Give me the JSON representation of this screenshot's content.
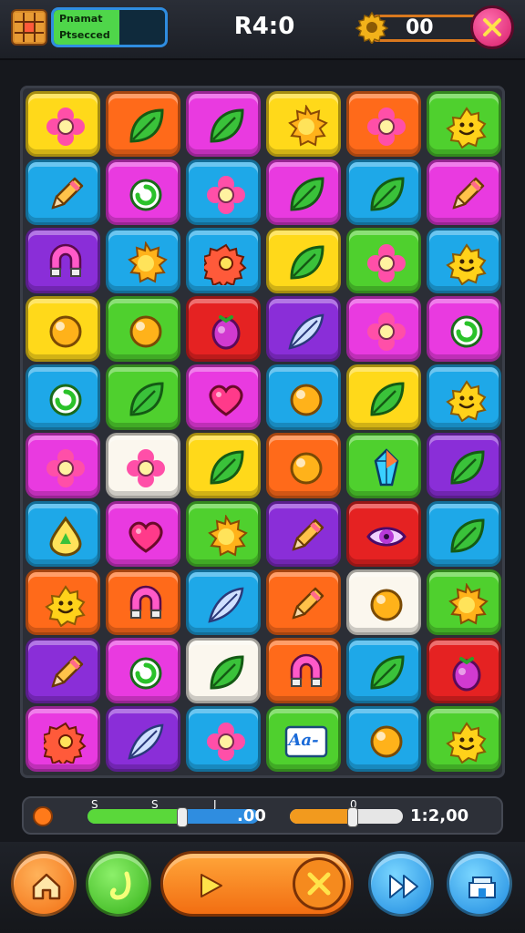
{
  "header": {
    "player_line1": "Pnamat",
    "player_line2": "Ptsecced",
    "score": "R4:0",
    "coins": "00"
  },
  "progress": {
    "left_labels": [
      "S",
      "S",
      "J"
    ],
    "left_value": ".00",
    "left_fill": 0.55,
    "right_label": "0",
    "right_value": "1:2,00",
    "right_fill": 0.55
  },
  "colors": {
    "yellow": "#ffd91a",
    "orange": "#ff6a1a",
    "magenta": "#e93ae0",
    "blue": "#1ea8e8",
    "green": "#4fd02e",
    "purple": "#8a2ed8",
    "red": "#e52222",
    "white": "#fbf7ee"
  },
  "grid": [
    [
      {
        "bg": "yellow",
        "icon": "flower-icon"
      },
      {
        "bg": "orange",
        "icon": "leaf-icon"
      },
      {
        "bg": "magenta",
        "icon": "leaf-icon"
      },
      {
        "bg": "yellow",
        "icon": "sun-icon"
      },
      {
        "bg": "orange",
        "icon": "flower-icon"
      },
      {
        "bg": "green",
        "icon": "smiley-icon"
      }
    ],
    [
      {
        "bg": "blue",
        "icon": "pencil-icon"
      },
      {
        "bg": "magenta",
        "icon": "swirl-icon"
      },
      {
        "bg": "blue",
        "icon": "flower-icon"
      },
      {
        "bg": "magenta",
        "icon": "leaf-icon"
      },
      {
        "bg": "blue",
        "icon": "leaf-icon"
      },
      {
        "bg": "magenta",
        "icon": "pencil-icon"
      }
    ],
    [
      {
        "bg": "purple",
        "icon": "magnet-icon"
      },
      {
        "bg": "blue",
        "icon": "sun-icon"
      },
      {
        "bg": "blue",
        "icon": "gear-icon"
      },
      {
        "bg": "yellow",
        "icon": "leaf-icon"
      },
      {
        "bg": "green",
        "icon": "flower-icon"
      },
      {
        "bg": "blue",
        "icon": "smiley-icon"
      }
    ],
    [
      {
        "bg": "yellow",
        "icon": "orb-icon"
      },
      {
        "bg": "green",
        "icon": "orb-icon"
      },
      {
        "bg": "red",
        "icon": "berry-icon"
      },
      {
        "bg": "purple",
        "icon": "feather-icon"
      },
      {
        "bg": "magenta",
        "icon": "flower-icon"
      },
      {
        "bg": "magenta",
        "icon": "swirl-icon"
      }
    ],
    [
      {
        "bg": "blue",
        "icon": "swirl-icon"
      },
      {
        "bg": "green",
        "icon": "leaf-icon"
      },
      {
        "bg": "magenta",
        "icon": "heart-icon"
      },
      {
        "bg": "blue",
        "icon": "orb-icon"
      },
      {
        "bg": "yellow",
        "icon": "leaf-icon"
      },
      {
        "bg": "blue",
        "icon": "smiley-icon"
      }
    ],
    [
      {
        "bg": "magenta",
        "icon": "flower-icon"
      },
      {
        "bg": "white",
        "icon": "flower-icon"
      },
      {
        "bg": "yellow",
        "icon": "leaf-icon"
      },
      {
        "bg": "orange",
        "icon": "orb-icon"
      },
      {
        "bg": "green",
        "icon": "crystal-icon"
      },
      {
        "bg": "purple",
        "icon": "leaf-icon"
      }
    ],
    [
      {
        "bg": "blue",
        "icon": "drop-icon"
      },
      {
        "bg": "magenta",
        "icon": "heart-icon"
      },
      {
        "bg": "green",
        "icon": "sun-icon"
      },
      {
        "bg": "purple",
        "icon": "pencil-icon"
      },
      {
        "bg": "red",
        "icon": "eye-icon"
      },
      {
        "bg": "blue",
        "icon": "leaf-icon"
      }
    ],
    [
      {
        "bg": "orange",
        "icon": "smiley-icon"
      },
      {
        "bg": "orange",
        "icon": "magnet-icon"
      },
      {
        "bg": "blue",
        "icon": "feather-icon"
      },
      {
        "bg": "orange",
        "icon": "pencil-icon"
      },
      {
        "bg": "white",
        "icon": "orb-icon"
      },
      {
        "bg": "green",
        "icon": "sun-icon"
      }
    ],
    [
      {
        "bg": "purple",
        "icon": "pencil-icon"
      },
      {
        "bg": "magenta",
        "icon": "swirl-icon"
      },
      {
        "bg": "white",
        "icon": "leaf-icon"
      },
      {
        "bg": "orange",
        "icon": "magnet-icon"
      },
      {
        "bg": "blue",
        "icon": "leaf-icon"
      },
      {
        "bg": "red",
        "icon": "berry-icon"
      }
    ],
    [
      {
        "bg": "magenta",
        "icon": "gear-icon"
      },
      {
        "bg": "purple",
        "icon": "feather-icon"
      },
      {
        "bg": "blue",
        "icon": "flower-icon"
      },
      {
        "bg": "green",
        "icon": "label-tile-icon",
        "text": "Aa-"
      },
      {
        "bg": "blue",
        "icon": "orb-icon"
      },
      {
        "bg": "green",
        "icon": "smiley-icon"
      }
    ]
  ]
}
